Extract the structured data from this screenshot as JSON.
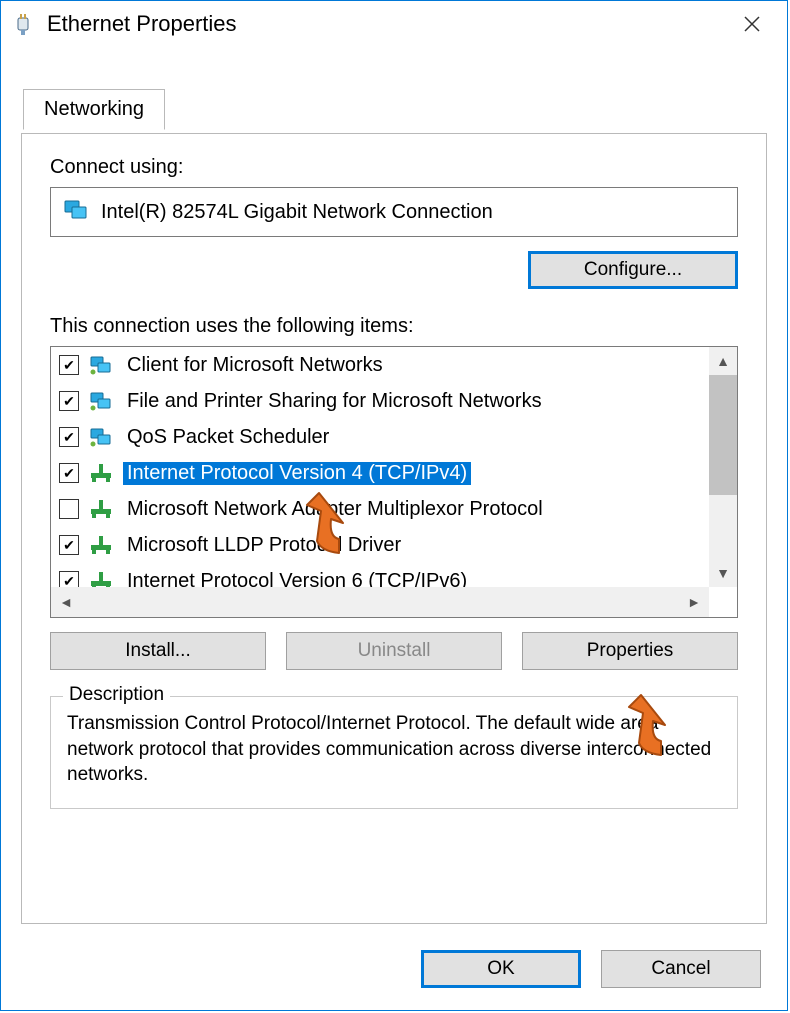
{
  "title": "Ethernet Properties",
  "tab": "Networking",
  "connect_using_label": "Connect using:",
  "adapter_name": "Intel(R) 82574L Gigabit Network Connection",
  "configure_label": "Configure...",
  "items_label": "This connection uses the following items:",
  "items": [
    {
      "checked": true,
      "icon": "pc",
      "label": "Client for Microsoft Networks",
      "selected": false
    },
    {
      "checked": true,
      "icon": "pc",
      "label": "File and Printer Sharing for Microsoft Networks",
      "selected": false
    },
    {
      "checked": true,
      "icon": "pc",
      "label": "QoS Packet Scheduler",
      "selected": false
    },
    {
      "checked": true,
      "icon": "net",
      "label": "Internet Protocol Version 4 (TCP/IPv4)",
      "selected": true
    },
    {
      "checked": false,
      "icon": "net",
      "label": "Microsoft Network Adapter Multiplexor Protocol",
      "selected": false
    },
    {
      "checked": true,
      "icon": "net",
      "label": "Microsoft LLDP Protocol Driver",
      "selected": false
    },
    {
      "checked": true,
      "icon": "net",
      "label": "Internet Protocol Version 6 (TCP/IPv6)",
      "selected": false
    }
  ],
  "buttons": {
    "install": "Install...",
    "uninstall": "Uninstall",
    "properties": "Properties"
  },
  "description": {
    "legend": "Description",
    "text": "Transmission Control Protocol/Internet Protocol. The default wide area network protocol that provides communication across diverse interconnected networks."
  },
  "footer": {
    "ok": "OK",
    "cancel": "Cancel"
  }
}
